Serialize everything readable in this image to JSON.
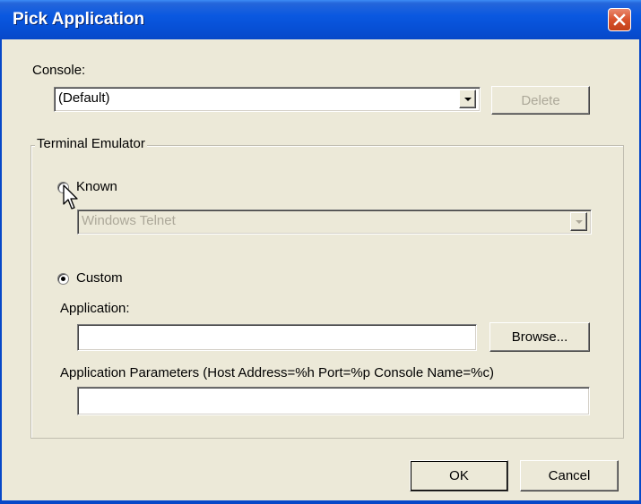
{
  "window": {
    "title": "Pick Application"
  },
  "console": {
    "label": "Console:",
    "selected": "(Default)",
    "delete_label": "Delete"
  },
  "terminal": {
    "group_label": "Terminal Emulator",
    "known_label": "Known",
    "known_selected": "Windows Telnet",
    "custom_label": "Custom",
    "application_label": "Application:",
    "application_value": "",
    "browse_label": "Browse...",
    "params_label": "Application Parameters (Host Address=%h Port=%p Console Name=%c)",
    "params_value": ""
  },
  "footer": {
    "ok_label": "OK",
    "cancel_label": "Cancel"
  },
  "colors": {
    "titlebar": "#0A58E0",
    "dialog_bg": "#ECE9D8",
    "close": "#D9522C",
    "disabled_text": "#ACA899"
  }
}
